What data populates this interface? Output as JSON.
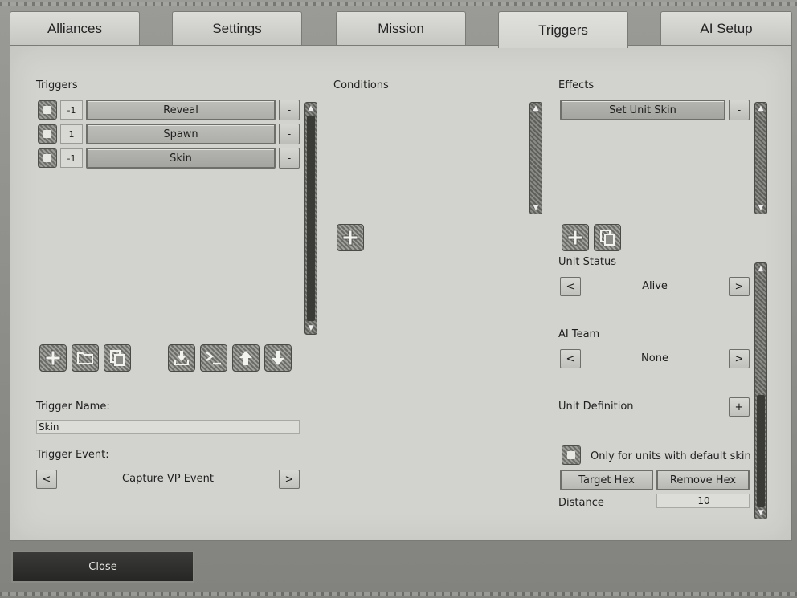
{
  "tabs": [
    {
      "label": "Alliances",
      "active": false
    },
    {
      "label": "Settings",
      "active": false
    },
    {
      "label": "Mission",
      "active": false
    },
    {
      "label": "Triggers",
      "active": true
    },
    {
      "label": "AI Setup",
      "active": false
    }
  ],
  "triggers": {
    "heading": "Triggers",
    "items": [
      {
        "count": "-1",
        "label": "Reveal"
      },
      {
        "count": "1",
        "label": "Spawn"
      },
      {
        "count": "-1",
        "label": "Skin"
      }
    ],
    "remove_label": "-",
    "toolbar_icons": [
      "plus-icon",
      "folder-icon",
      "copy-icon",
      "import-icon",
      "terminal-icon",
      "arrow-up-icon",
      "arrow-down-icon"
    ],
    "name_label": "Trigger Name:",
    "name_value": "Skin",
    "event_label": "Trigger Event:",
    "event_value": "Capture VP Event",
    "prev": "<",
    "next": ">"
  },
  "conditions": {
    "heading": "Conditions"
  },
  "effects": {
    "heading": "Effects",
    "items": [
      {
        "label": "Set Unit Skin"
      }
    ],
    "remove_label": "-"
  },
  "effect_params": {
    "unit_status_label": "Unit Status",
    "unit_status_value": "Alive",
    "ai_team_label": "AI Team",
    "ai_team_value": "None",
    "unit_definition_label": "Unit Definition",
    "add_label": "+",
    "default_skin_label": "Only for units with default skin",
    "target_hex_label": "Target Hex",
    "remove_hex_label": "Remove Hex",
    "distance_label": "Distance",
    "distance_value": "10",
    "prev": "<",
    "next": ">"
  },
  "footer": {
    "close_label": "Close"
  }
}
